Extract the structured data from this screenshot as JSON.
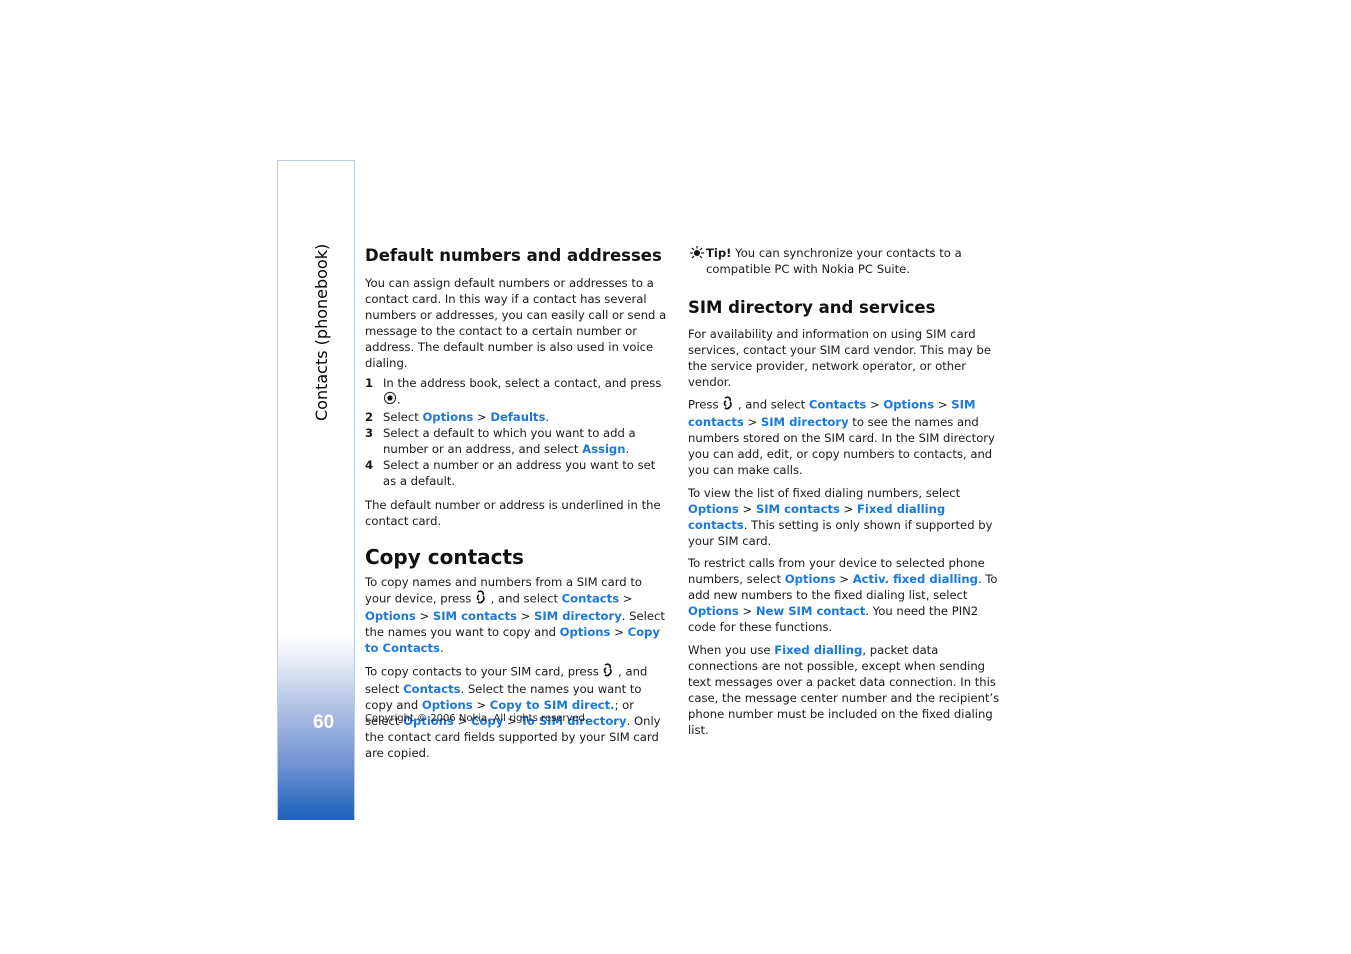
{
  "sidebar": {
    "section_title": "Contacts (phonebook)",
    "page_number": "60"
  },
  "left": {
    "default_numbers": {
      "heading": "Default numbers and addresses",
      "intro": "You can assign default numbers or addresses to a contact card. In this way if a contact has several numbers or addresses, you can easily call or send a message to the contact to a certain number or address. The default number is also used in voice dialing.",
      "steps": [
        {
          "num": "1",
          "text": "In the address book, select a contact, and press",
          "icon": "navi-key-press-icon",
          "after": "."
        },
        {
          "num": "2",
          "pre": "Select ",
          "link1": "Options",
          "sep": " > ",
          "link2": "Defaults",
          "after": "."
        },
        {
          "num": "3",
          "pre": "Select a default to which you want to add a number or an address, and select ",
          "link1": "Assign",
          "after": "."
        },
        {
          "num": "4",
          "text": "Select a number or an address you want to set as a default."
        }
      ],
      "outro": "The default number or address is underlined in the contact card."
    },
    "copy_contacts": {
      "heading": "Copy contacts",
      "p1": {
        "t1": "To copy names and numbers from a SIM card to your device, press ",
        "t2": " , and select ",
        "l1": "Contacts",
        "sep": " > ",
        "l2": "Options",
        "l3": "SIM contacts",
        "l4": "SIM directory",
        "t3": ". Select the names you want to copy and ",
        "l5": "Options",
        "l6": "Copy to Contacts",
        "t4": "."
      },
      "p2": {
        "t1": "To copy contacts to your SIM card, press ",
        "t2": " , and select ",
        "l1": "Contacts",
        "t3": ". Select the names you want to copy and ",
        "l2": "Options",
        "sep": " > ",
        "l3": "Copy to SIM direct.",
        "t4": "; or select ",
        "l4": "Options",
        "l5": "Copy",
        "l6": "To SIM directory",
        "t5": ". Only the contact card fields supported by your SIM card are copied."
      }
    },
    "copyright": "Copyright © 2006 Nokia. All rights reserved."
  },
  "right": {
    "tip": {
      "label": "Tip!",
      "text": " You can synchronize your contacts to a compatible PC with Nokia PC Suite."
    },
    "sim_directory": {
      "heading": "SIM directory and services",
      "p1": "For availability and information on using SIM card services, contact your SIM card vendor. This may be the service provider, network operator, or other vendor.",
      "p2": {
        "t1": "Press ",
        "t2": " , and select ",
        "l1": "Contacts",
        "sep": " > ",
        "l2": "Options",
        "l3": "SIM contacts",
        "l4": "SIM directory",
        "t3": " to see the names and numbers stored on the SIM card. In the SIM directory you can add, edit, or copy numbers to contacts, and you can make calls."
      },
      "p3": {
        "t1": "To view the list of fixed dialing numbers, select ",
        "l1": "Options",
        "sep": " > ",
        "l2": "SIM contacts",
        "l3": "Fixed dialling contacts",
        "t2": ". This setting is only shown if supported by your SIM card."
      },
      "p4": {
        "t1": "To restrict calls from your device to selected phone numbers, select ",
        "l1": "Options",
        "sep": " > ",
        "l2": "Activ. fixed dialling",
        "t2": ". To add new numbers to the fixed dialing list, select ",
        "l3": "Options",
        "l4": "New SIM contact",
        "t3": ". You need the PIN2 code for these functions."
      },
      "p5": {
        "t1": "When you use ",
        "l1": "Fixed dialling",
        "t2": ", packet data connections are not possible, except when sending text messages over a packet data connection. In this case, the message center number and the recipient’s phone number must be included on the fixed dialing list."
      }
    }
  },
  "colors": {
    "link": "#1a78e0",
    "sidebar_gradient_end": "#1f63bb",
    "sidebar_border": "#b8cce8"
  }
}
